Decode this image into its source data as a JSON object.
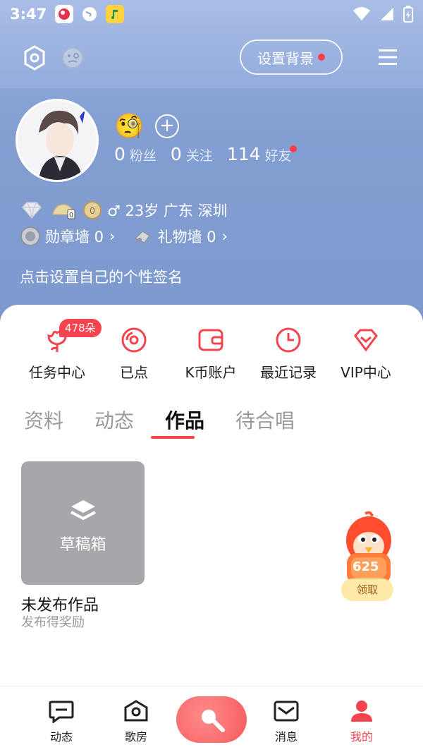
{
  "status_bar": {
    "time": "3:47"
  },
  "top_bar": {
    "bg_button_label": "设置背景"
  },
  "profile": {
    "stats": [
      {
        "num": "0",
        "label": "粉丝"
      },
      {
        "num": "0",
        "label": "关注"
      },
      {
        "num": "114",
        "label": "好友"
      }
    ],
    "level_chip": "0",
    "coin_chip": "0",
    "info": "♂ 23岁  广东 深圳",
    "medal_wall": "勋章墙 0",
    "gift_wall": "礼物墙 0",
    "signature": "点击设置自己的个性签名"
  },
  "quick_actions": {
    "badge": "478朵",
    "items": [
      "任务中心",
      "已点",
      "K币账户",
      "最近记录",
      "VIP中心"
    ]
  },
  "tabs": [
    "资料",
    "动态",
    "作品",
    "待合唱"
  ],
  "works": {
    "draft_label": "草稿箱",
    "unpublished_title": "未发布作品",
    "unpublished_sub": "发布得奖励"
  },
  "mascot": {
    "count": "625",
    "claim_label": "领取"
  },
  "bottom_nav": [
    "动态",
    "歌房",
    "消息",
    "我的"
  ],
  "colors": {
    "accent": "#f5444f",
    "header": "#839fd2"
  }
}
